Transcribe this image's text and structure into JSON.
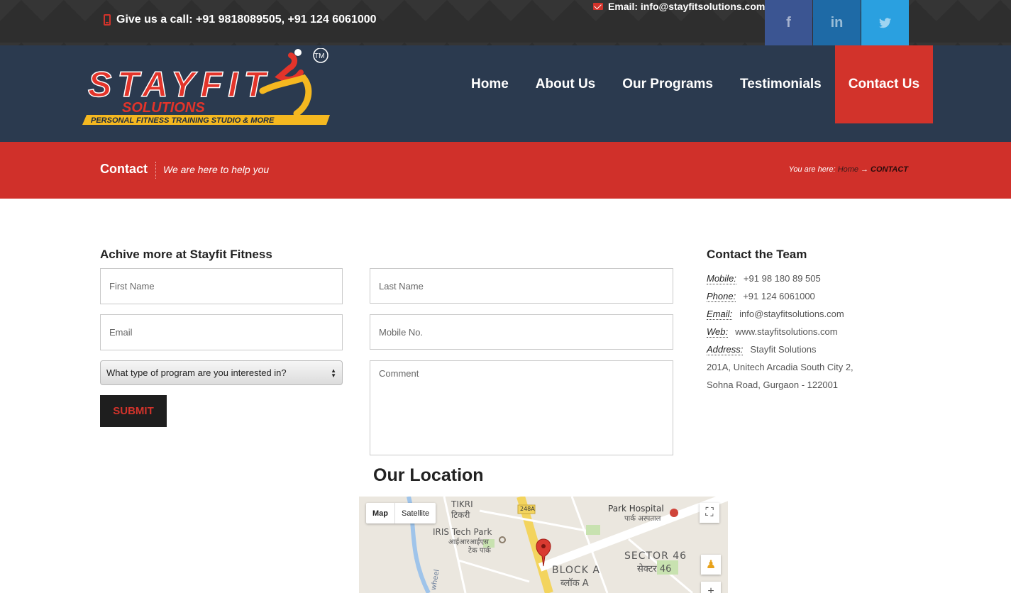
{
  "topbar": {
    "call": "Give us a call: +91 9818089505, +91 124 6061000",
    "email": "Email: info@stayfitsolutions.com",
    "social": {
      "facebook": "f",
      "linkedin": "in",
      "twitter": "t"
    }
  },
  "logo": {
    "brand": "STAYFIT",
    "brand2": "SOLUTIONS",
    "tagline": "PERSONAL FITNESS TRAINING STUDIO & MORE",
    "tm": "TM"
  },
  "nav": [
    "Home",
    "About Us",
    "Our Programs",
    "Testimonials",
    "Contact Us"
  ],
  "band": {
    "title": "Contact",
    "subtitle": "We are here to help you",
    "crumb_prefix": "You are here:",
    "crumb_home": "Home",
    "crumb_arrow": "→",
    "crumb_current": "CONTACT"
  },
  "form": {
    "heading": "Achive more at Stayfit Fitness",
    "first_name": "First Name",
    "last_name": "Last Name",
    "email": "Email",
    "mobile": "Mobile No.",
    "program": "What type of program are you interested in?",
    "comment": "Comment",
    "submit": "SUBMIT"
  },
  "team": {
    "heading": "Contact the Team",
    "mobile_label": "Mobile:",
    "mobile": "+91 98 180 89 505",
    "phone_label": "Phone:",
    "phone": "+91 124 6061000",
    "email_label": "Email:",
    "email": "info@stayfitsolutions.com",
    "web_label": "Web:",
    "web": "www.stayfitsolutions.com",
    "address_label": "Address:",
    "address1": "Stayfit Solutions",
    "address2": "201A, Unitech Arcadia South City 2,",
    "address3": "Sohna Road, Gurgaon - 122001"
  },
  "location": {
    "heading": "Our Location",
    "map_btn": "Map",
    "satellite_btn": "Satellite",
    "labels": {
      "tikri": "TIKRI",
      "tikri_hi": "टिकरी",
      "iris": "IRIS Tech Park",
      "iris_hi1": "आईआरआईएस",
      "iris_hi2": "टेक पार्क",
      "park": "Park Hospital",
      "park_hi": "पार्क अस्पताल",
      "sector": "SECTOR 46",
      "sector_hi": "सेक्टर 46",
      "block": "BLOCK A",
      "block_hi": "ब्लॉक A",
      "road": "248A",
      "wheel": "wheel"
    }
  }
}
